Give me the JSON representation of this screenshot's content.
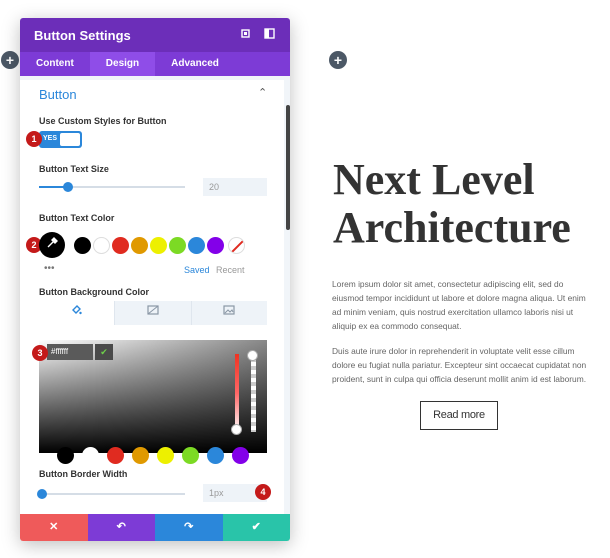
{
  "panel": {
    "title": "Button Settings",
    "tabs": [
      {
        "label": "Content"
      },
      {
        "label": "Design"
      },
      {
        "label": "Advanced"
      }
    ],
    "section_title": "Button",
    "custom_styles": {
      "label": "Use Custom Styles for Button",
      "toggle_label": "YES",
      "enabled": true
    },
    "text_size": {
      "label": "Button Text Size",
      "value": "20",
      "level": 0.2
    },
    "text_color": {
      "label": "Button Text Color",
      "saved_label": "Saved",
      "recent_label": "Recent"
    },
    "bg_color": {
      "label": "Button Background Color",
      "hex_value": "#ffffff"
    },
    "border_width": {
      "label": "Button Border Width",
      "value": "1px",
      "level": 0.02
    },
    "badges": [
      "1",
      "2",
      "3",
      "4"
    ],
    "footer": [
      "cancel",
      "undo",
      "redo",
      "save"
    ]
  },
  "swatches": [
    "#000000",
    "#ffffff",
    "#e02b20",
    "#e09900",
    "#edf000",
    "#7cda24",
    "#2b87da",
    "#8300e9"
  ],
  "preview": {
    "heading": "Next Level Architecture",
    "para1": "Lorem ipsum dolor sit amet, consectetur adipiscing elit, sed do eiusmod tempor incididunt ut labore et dolore magna aliqua. Ut enim ad minim veniam, quis nostrud exercitation ullamco laboris nisi ut aliquip ex ea commodo consequat.",
    "para2": "Duis aute irure dolor in reprehenderit in voluptate velit esse cillum dolore eu fugiat nulla pariatur. Excepteur sint occaecat cupidatat non proident, sunt in culpa qui officia deserunt mollit anim id est laborum.",
    "button": "Read more"
  },
  "colors": {
    "header": "#6c2eb9",
    "tabs": "#7d3bd6",
    "accent": "#2b87da",
    "badge": "#c41a1a",
    "cancel": "#ef5a5a",
    "undo": "#7d3bd6",
    "redo": "#2b87da",
    "save": "#29c4a9"
  }
}
